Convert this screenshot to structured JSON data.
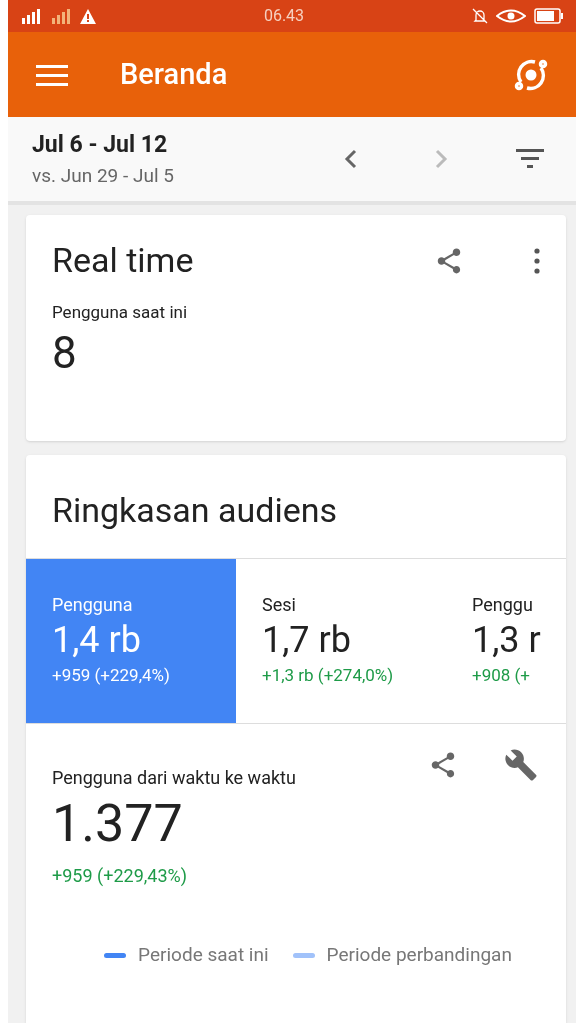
{
  "status_bar": {
    "time": "06.43"
  },
  "app_bar": {
    "title": "Beranda"
  },
  "date_range": {
    "current": "Jul 6 - Jul 12",
    "comparison": "vs. Jun 29 - Jul 5",
    "prev_disabled": false,
    "next_disabled": true
  },
  "realtime_card": {
    "title": "Real time",
    "label": "Pengguna saat ini",
    "value": "8"
  },
  "audience_card": {
    "title": "Ringkasan audiens",
    "metrics": [
      {
        "label": "Pengguna",
        "value": "1,4 rb",
        "change": "+959 (+229,4%)",
        "selected": true
      },
      {
        "label": "Sesi",
        "value": "1,7 rb",
        "change": "+1,3 rb (+274,0%)",
        "selected": false
      },
      {
        "label": "Penggu",
        "value": "1,3 r",
        "change": "+908 (+",
        "selected": false
      }
    ],
    "chart_title": "Pengguna dari waktu ke waktu",
    "total": "1.377",
    "total_change": "+959 (+229,43%)",
    "legend": [
      {
        "label": "Periode saat ini",
        "color": "#4285f4"
      },
      {
        "label": "Periode perbandingan",
        "color": "#a1c2fa"
      }
    ]
  }
}
